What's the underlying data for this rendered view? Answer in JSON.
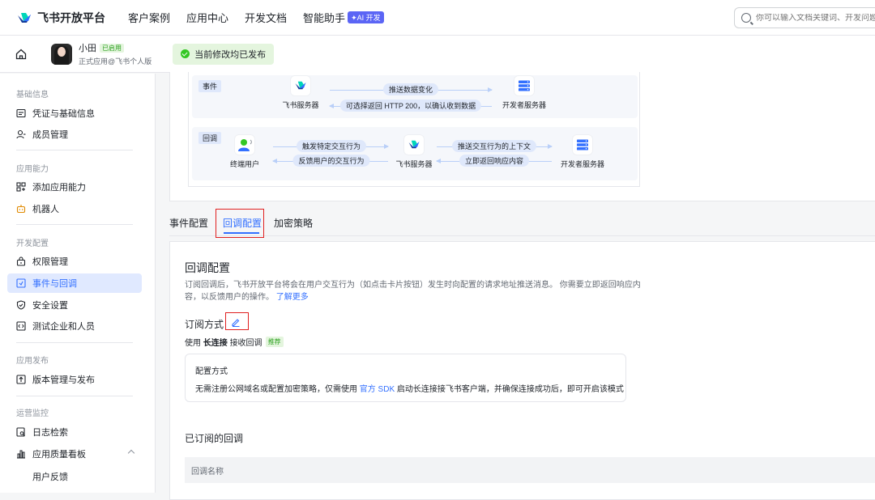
{
  "header": {
    "logo_text": "飞书开放平台",
    "nav": [
      "客户案例",
      "应用中心",
      "开发文档",
      "智能助手"
    ],
    "ai_badge": "✦AI 开发",
    "search_placeholder": "你可以输入文档关键词、开发问题"
  },
  "app": {
    "name": "小田",
    "status": "已启用",
    "subtitle": "正式应用@飞书个人版",
    "publish_status": "当前修改均已发布"
  },
  "sidebar": {
    "sections": [
      {
        "title": "基础信息",
        "items": [
          "凭证与基础信息",
          "成员管理"
        ]
      },
      {
        "title": "应用能力",
        "items": [
          "添加应用能力",
          "机器人"
        ]
      },
      {
        "title": "开发配置",
        "items": [
          "权限管理",
          "事件与回调",
          "安全设置",
          "测试企业和人员"
        ]
      },
      {
        "title": "应用发布",
        "items": [
          "版本管理与发布"
        ]
      },
      {
        "title": "运营监控",
        "items": [
          "日志检索",
          "应用质量看板"
        ]
      }
    ],
    "sub_item": "用户反馈",
    "active": "事件与回调"
  },
  "diagram": {
    "event": {
      "tag": "事件",
      "node_left": "飞书服务器",
      "node_right": "开发者服务器",
      "arrow_push": "推送数据变化",
      "arrow_back": "可选择返回 HTTP 200，以确认收到数据"
    },
    "callback": {
      "tag": "回调",
      "node_user": "终端用户",
      "node_mid": "飞书服务器",
      "node_dev": "开发者服务器",
      "arrow_trigger": "触发特定交互行为",
      "arrow_feedback": "反馈用户的交互行为",
      "arrow_push_ctx": "推送交互行为的上下文",
      "arrow_reply": "立即返回响应内容"
    }
  },
  "tabs": [
    "事件配置",
    "回调配置",
    "加密策略"
  ],
  "active_tab": "回调配置",
  "panel": {
    "title": "回调配置",
    "desc": "订阅回调后，飞书开放平台将会在用户交互行为（如点击卡片按钮）发生时向配置的请求地址推送消息。 你需要立即返回响应内容，以反馈用户的操作。",
    "learn_more": "了解更多",
    "sub_label": "订阅方式",
    "use_prefix": "使用",
    "use_mode": "长连接",
    "use_suffix": "接收回调",
    "recommend": "推荐",
    "cfg_title": "配置方式",
    "cfg_desc_1": "无需注册公网域名或配置加密策略，仅需使用",
    "cfg_sdk": "官方 SDK",
    "cfg_desc_2": "启动长连接接飞书客户端，并确保连接成功后，即可开启该模式",
    "subscribed_title": "已订阅的回调",
    "table_col": "回调名称"
  }
}
